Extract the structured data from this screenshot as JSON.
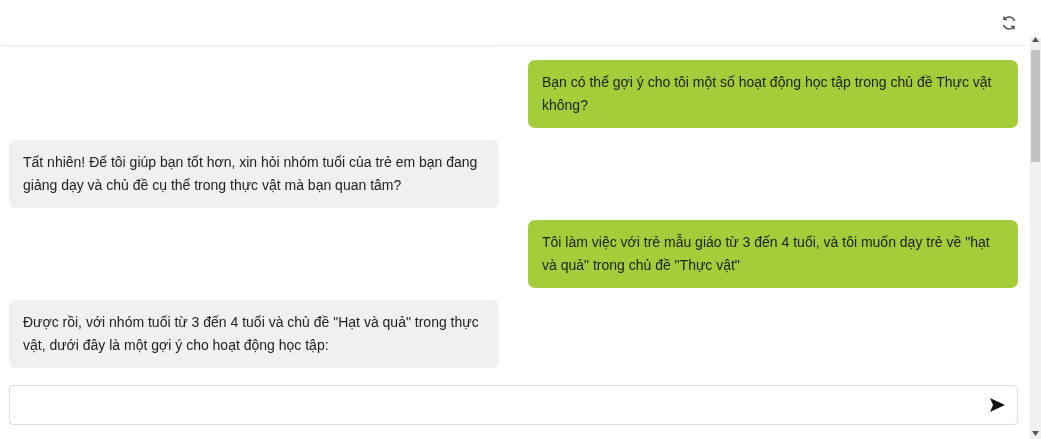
{
  "messages": [
    {
      "kind": "user",
      "text": "Bạn có thể gợi ý cho tôi một số hoạt động học tập trong chủ đề Thực vật không?"
    },
    {
      "kind": "assistant",
      "text": "Tất nhiên! Để tôi giúp bạn tốt hơn, xin hỏi nhóm tuổi của trẻ em bạn đang giảng dạy và chủ đề cụ thể trong thực vật mà bạn quan tâm?"
    },
    {
      "kind": "user",
      "text": "Tôi làm việc với trẻ mẫu giáo từ 3 đến 4 tuổi, và tôi muốn dạy trẻ về \"hạt và quả\" trong chủ đề \"Thực vật\""
    },
    {
      "kind": "assistant",
      "text": "Được rồi, với nhóm tuổi từ 3 đến 4 tuổi và chủ đề \"Hạt và quả\" trong thực vật, dưới đây là một gợi ý cho hoạt động học tập:"
    }
  ]
}
